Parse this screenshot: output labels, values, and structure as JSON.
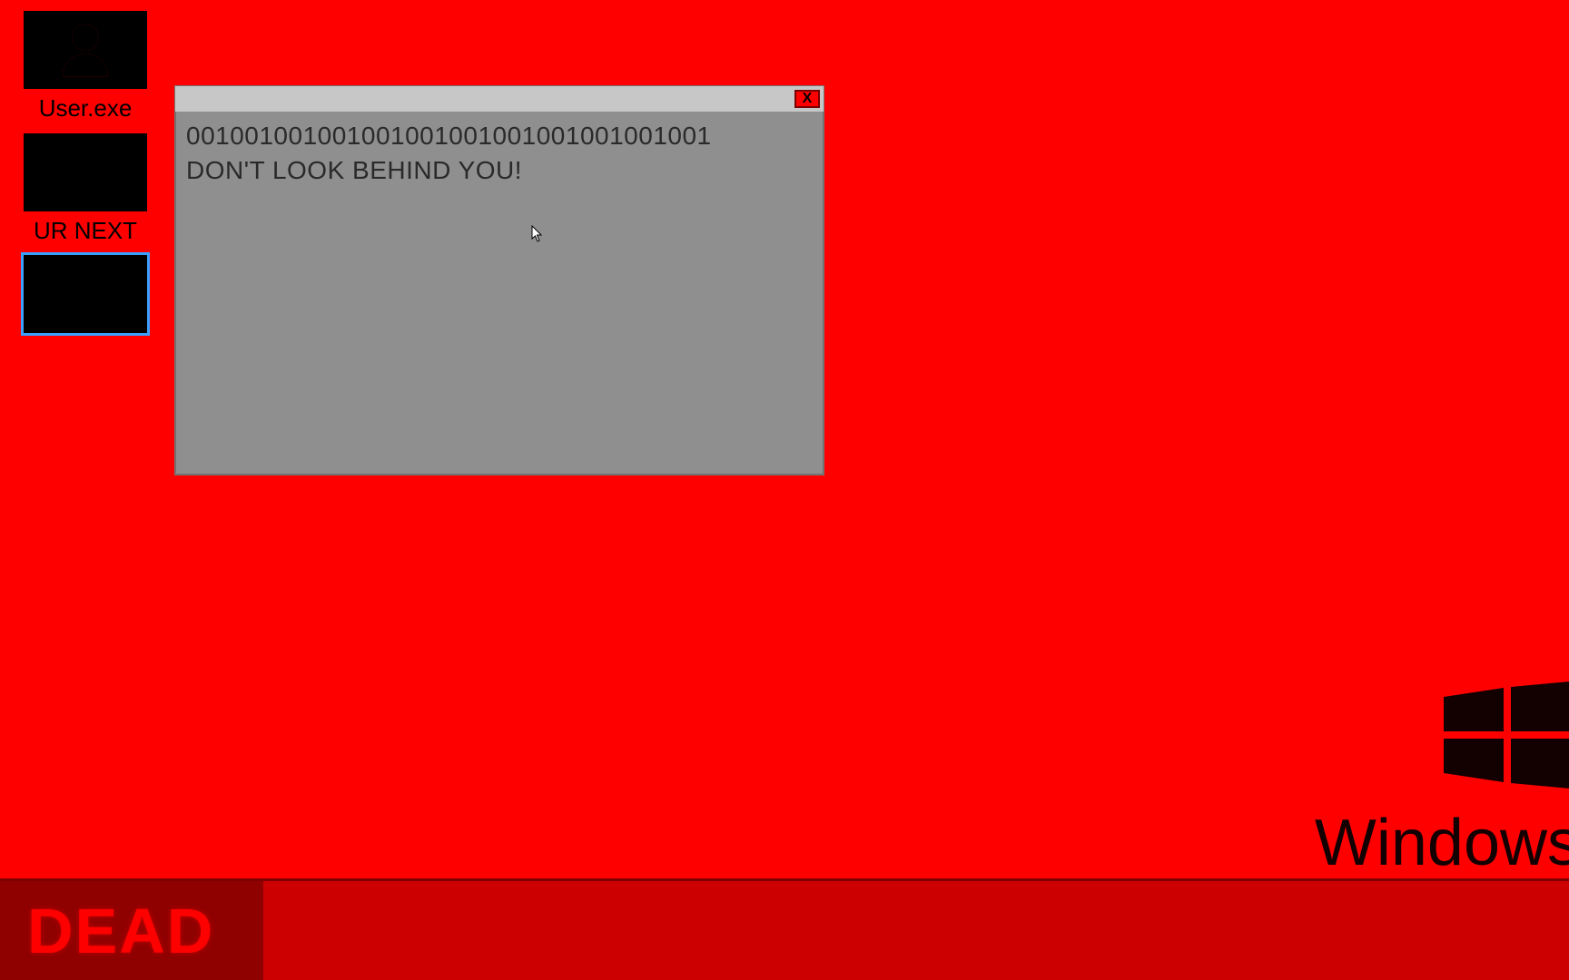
{
  "desktop": {
    "background_color": "#ff0000",
    "icons": [
      {
        "name": "user-exe",
        "label": "User.exe",
        "selected": false,
        "has_user_glyph": true
      },
      {
        "name": "ur-next",
        "label": "UR NEXT",
        "selected": false,
        "has_user_glyph": false
      },
      {
        "name": "blank",
        "label": "",
        "selected": true,
        "has_user_glyph": false
      }
    ]
  },
  "popup": {
    "close_label": "X",
    "line1": "001001001001001001001001001001001001",
    "line2": "DON'T LOOK BEHIND YOU!"
  },
  "watermark": {
    "text": "Windows"
  },
  "taskbar": {
    "start_label": "DEAD"
  },
  "colors": {
    "bg": "#ff0000",
    "taskbar": "#cc0000",
    "start_btn": "#8f0000",
    "window_body": "#8f8f8f",
    "titlebar": "#c7c7c7",
    "close": "#ff0000"
  }
}
